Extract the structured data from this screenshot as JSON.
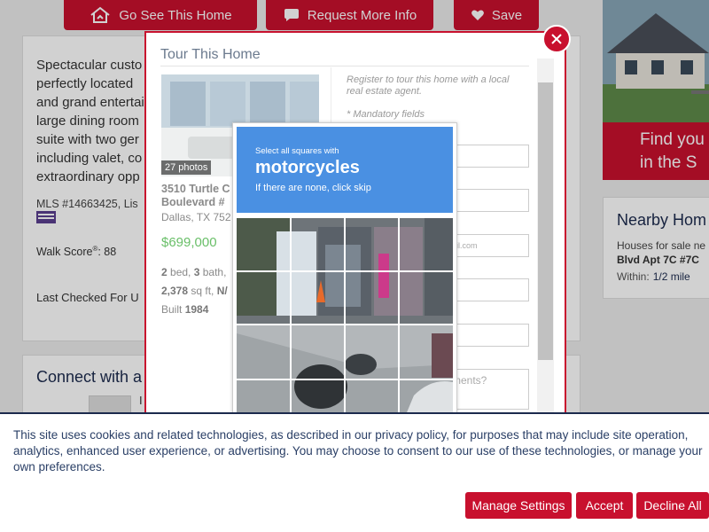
{
  "top_buttons": {
    "go_see": "Go See This Home",
    "request_info": "Request More Info",
    "save": "Save"
  },
  "listing": {
    "description_partial": "Spectacular custo perfectly located and grand entertai large dining room suite with two ger including valet, co extraordinary opp",
    "mls": "MLS #14663425, Lis",
    "walk_score_label": "Walk Score",
    "walk_score_sup": "®",
    "walk_score_value": ": 88",
    "last_checked": "Last Checked For U"
  },
  "connect": {
    "title": "Connect with a",
    "initial": "I"
  },
  "ad": {
    "line1": "Find you",
    "line2": "in the S"
  },
  "nearby": {
    "title": "Nearby Hom",
    "subtitle": "Houses for sale ne",
    "address": "Blvd Apt 7C #7C",
    "within_label": "Within:",
    "within_value": "1/2 mile"
  },
  "modal": {
    "title": "Tour This Home",
    "photos": "27 photos",
    "address": "3510 Turtle C Boulevard #",
    "city": "Dallas, TX 752",
    "price": "$699,000",
    "beds": "2",
    "beds_label": " bed, ",
    "baths": "3",
    "baths_label": " bath,",
    "sqft": "2,378",
    "sqft_label": " sq ft, ",
    "sqft_extra": "N/",
    "built_label": "Built ",
    "built": "1984",
    "register_text": "Register to tour this home with a local real estate agent.",
    "mandatory": "* Mandatory fields",
    "email_placeholder": "ail.com",
    "comments_placeholder": "ments?"
  },
  "captcha": {
    "instruction": "Select all squares with",
    "target": "motorcycles",
    "skip": "If there are none, click skip"
  },
  "cookie": {
    "text": "This site uses cookies and related technologies, as described in our privacy policy, for purposes that may include site operation, analytics, enhanced user experience, or advertising. You may choose to consent to our use of these technologies, or manage your own preferences.",
    "manage": "Manage Settings",
    "accept": "Accept",
    "decline": "Decline All"
  },
  "colors": {
    "brand_red": "#c8102e",
    "navy": "#1c2a4d",
    "captcha_blue": "#4a90e2",
    "price_green": "#6abf69"
  }
}
